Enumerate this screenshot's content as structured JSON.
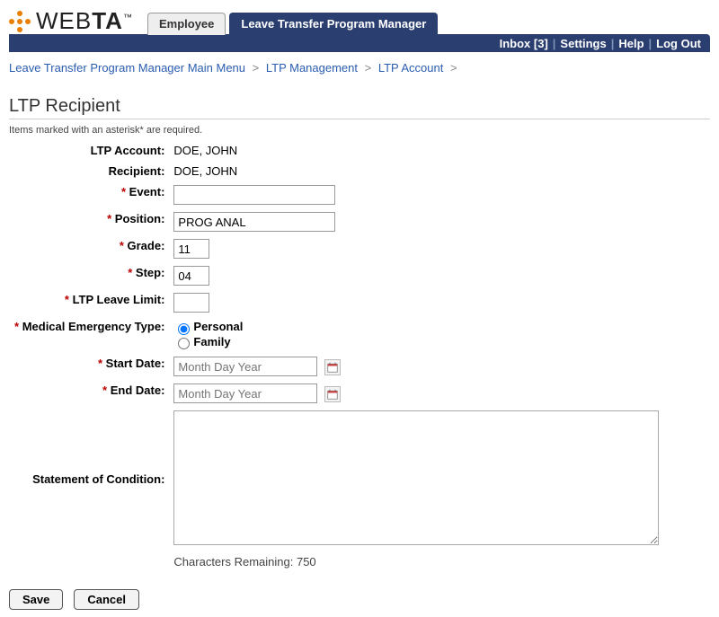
{
  "brand": {
    "logo_text_pre": "WEB",
    "logo_text_post": "TA",
    "tm": "™"
  },
  "tabs": {
    "employee": "Employee",
    "ltpm": "Leave Transfer Program Manager"
  },
  "topbar": {
    "inbox": "Inbox [3]",
    "settings": "Settings",
    "help": "Help",
    "logout": "Log Out"
  },
  "breadcrumb": {
    "main": "Leave Transfer Program Manager Main Menu",
    "mgmt": "LTP Management",
    "acct": "LTP Account"
  },
  "page_title": "LTP Recipient",
  "required_note": "Items marked with an asterisk* are required.",
  "labels": {
    "ltp_account": "LTP Account:",
    "recipient": "Recipient:",
    "event": "Event:",
    "position": "Position:",
    "grade": "Grade:",
    "step": "Step:",
    "ltp_leave_limit": "LTP Leave Limit:",
    "med_emergency": "Medical Emergency Type:",
    "start_date": "Start Date:",
    "end_date": "End Date:",
    "statement": "Statement of Condition:",
    "chars_remaining_prefix": "Characters Remaining: "
  },
  "values": {
    "ltp_account": "DOE, JOHN",
    "recipient": "DOE, JOHN",
    "event": "",
    "position": "PROG ANAL",
    "grade": "11",
    "step": "04",
    "ltp_leave_limit": "",
    "med_type_personal": "Personal",
    "med_type_family": "Family",
    "start_date_placeholder": "Month Day Year",
    "end_date_placeholder": "Month Day Year",
    "chars_remaining": "750"
  },
  "buttons": {
    "save": "Save",
    "cancel": "Cancel"
  }
}
